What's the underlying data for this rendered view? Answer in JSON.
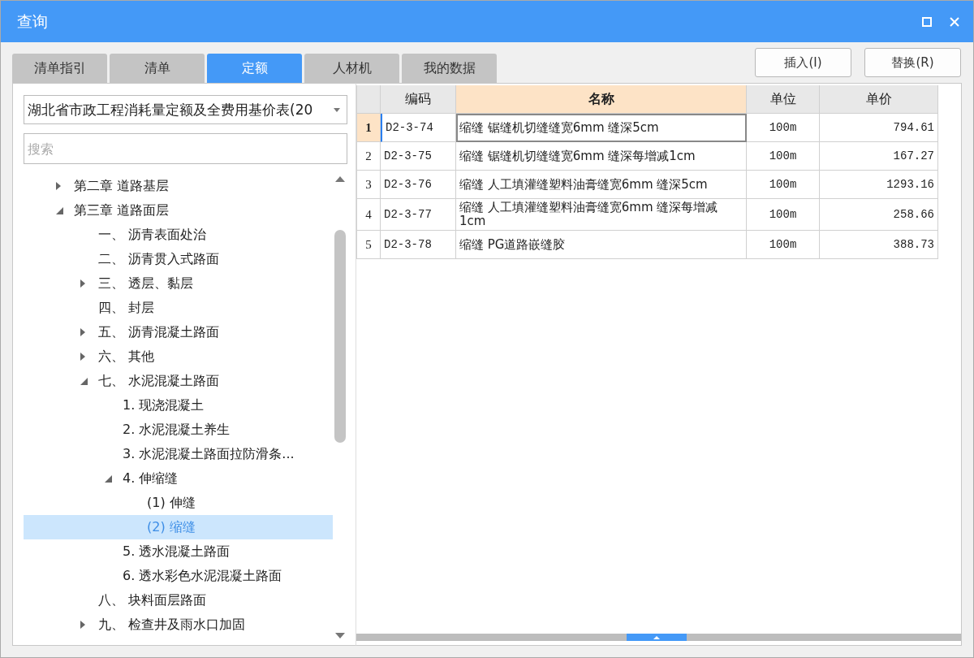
{
  "window": {
    "title": "查询"
  },
  "tabs": [
    {
      "label": "清单指引",
      "selected": false
    },
    {
      "label": "清单",
      "selected": false
    },
    {
      "label": "定额",
      "selected": true
    },
    {
      "label": "人材机",
      "selected": false
    },
    {
      "label": "我的数据",
      "selected": false
    }
  ],
  "buttons": [
    "插入(I)",
    "替换(R)"
  ],
  "library_select": {
    "value": "湖北省市政工程消耗量定额及全费用基价表(20"
  },
  "search": {
    "placeholder": "搜索"
  },
  "tree": [
    {
      "label": "第二章 道路基层",
      "expanded": false,
      "selected": false
    },
    {
      "label": "第三章 道路面层",
      "expanded": true,
      "selected": false,
      "children": [
        {
          "label": "一、 沥青表面处治",
          "selected": false
        },
        {
          "label": "二、 沥青贯入式路面",
          "selected": false
        },
        {
          "label": "三、 透层、黏层",
          "expanded": false,
          "selected": false
        },
        {
          "label": "四、 封层",
          "selected": false
        },
        {
          "label": "五、 沥青混凝土路面",
          "expanded": false,
          "selected": false
        },
        {
          "label": "六、 其他",
          "expanded": false,
          "selected": false
        },
        {
          "label": "七、 水泥混凝土路面",
          "expanded": true,
          "selected": false,
          "children": [
            {
              "label": "1. 现浇混凝土",
              "selected": false
            },
            {
              "label": "2. 水泥混凝土养生",
              "selected": false
            },
            {
              "label": "3. 水泥混凝土路面拉防滑条...",
              "selected": false
            },
            {
              "label": "4. 伸缩缝",
              "expanded": true,
              "selected": false,
              "children": [
                {
                  "label": "(1) 伸缝",
                  "selected": false
                },
                {
                  "label": "(2) 缩缝",
                  "selected": true
                }
              ]
            },
            {
              "label": "5. 透水混凝土路面",
              "selected": false
            },
            {
              "label": "6. 透水彩色水泥混凝土路面",
              "selected": false
            }
          ]
        },
        {
          "label": "八、 块料面层路面",
          "selected": false
        },
        {
          "label": "九、 检查井及雨水口加固",
          "expanded": false,
          "selected": false
        }
      ]
    }
  ],
  "table": {
    "columns": [
      {
        "label": "编码",
        "selected": false
      },
      {
        "label": "名称",
        "selected": true
      },
      {
        "label": "单位",
        "selected": false
      },
      {
        "label": "单价",
        "selected": false
      }
    ],
    "rows": [
      {
        "index": "1",
        "code": "D2-3-74",
        "name": "缩缝 锯缝机切缝缝宽6mm 缝深5cm",
        "unit": "100m",
        "price": "794.61",
        "selected": true
      },
      {
        "index": "2",
        "code": "D2-3-75",
        "name": "缩缝 锯缝机切缝缝宽6mm 缝深每增减1cm",
        "unit": "100m",
        "price": "167.27",
        "selected": false
      },
      {
        "index": "3",
        "code": "D2-3-76",
        "name": "缩缝 人工填灌缝塑料油膏缝宽6mm 缝深5cm",
        "unit": "100m",
        "price": "1293.16",
        "selected": false
      },
      {
        "index": "4",
        "code": "D2-3-77",
        "name": "缩缝 人工填灌缝塑料油膏缝宽6mm 缝深每增减1cm",
        "unit": "100m",
        "price": "258.66",
        "selected": false
      },
      {
        "index": "5",
        "code": "D2-3-78",
        "name": "缩缝 PG道路嵌缝胶",
        "unit": "100m",
        "price": "388.73",
        "selected": false
      }
    ]
  }
}
